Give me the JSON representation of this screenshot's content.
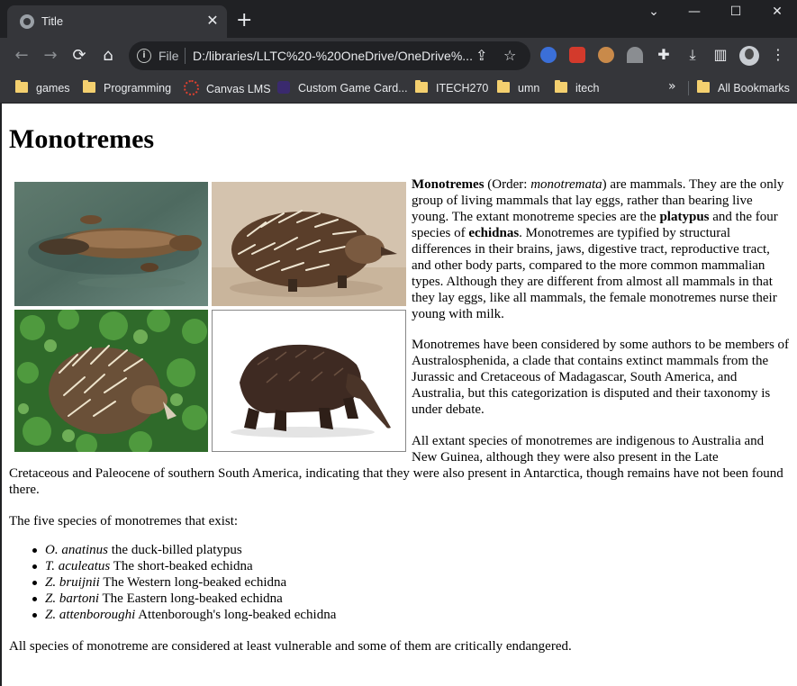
{
  "browser": {
    "tab": {
      "title": "Title",
      "close_glyph": "✕",
      "favicon": "globe-icon"
    },
    "new_tab_glyph": "+",
    "window_controls": {
      "collapse": "⌄",
      "minimize": "—",
      "maximize": "☐",
      "close": "✕"
    },
    "toolbar": {
      "back": "←",
      "forward": "→",
      "reload": "⟳",
      "home": "⌂",
      "scheme": "File",
      "url": "D:/libraries/LLTC%20-%20OneDrive/OneDrive%...",
      "share": "⇪",
      "bookmark_star": "☆",
      "extensions_glyph": "✚",
      "download": "⤓",
      "side_panel": "▥",
      "menu": "⋮"
    },
    "bookmarks": {
      "items": [
        {
          "label": "games",
          "icon": "folder-icon"
        },
        {
          "label": "Programming",
          "icon": "folder-icon"
        },
        {
          "label": "Canvas LMS",
          "icon": "canvas-icon"
        },
        {
          "label": "Custom Game Card...",
          "icon": "hex-icon"
        },
        {
          "label": "ITECH270",
          "icon": "folder-icon"
        },
        {
          "label": "umn",
          "icon": "folder-icon"
        },
        {
          "label": "itech",
          "icon": "folder-icon"
        }
      ],
      "overflow_glyph": "»",
      "all_bookmarks": "All Bookmarks"
    }
  },
  "page": {
    "heading": "Monotremes",
    "images": [
      {
        "subject": "duck-billed platypus swimming"
      },
      {
        "subject": "short-beaked echidna walking"
      },
      {
        "subject": "echidna in grass"
      },
      {
        "subject": "long-beaked echidna"
      }
    ],
    "intro": {
      "b1": "Monotremes",
      "t1": " (Order: ",
      "i1": "monotremata",
      "t2": ") are mammals. They are the only group of living mammals that lay eggs, rather than bearing live young. The extant monotreme species are the ",
      "b2": "platypus",
      "t3": " and the four species of ",
      "b3": "echidnas",
      "t4": ". Monotremes are typified by structural differences in their brains, jaws, digestive tract, reproductive tract, and other body parts, compared to the more common mammalian types. Although they are different from almost all mammals in that they lay eggs, like all mammals, the female monotremes nurse their young with milk."
    },
    "paragraph2": "Monotremes have been considered by some authors to be members of Australosphenida, a clade that contains extinct mammals from the Jurassic and Cretaceous of Madagascar, South America, and Australia, but this categorization is disputed and their taxonomy is under debate.",
    "paragraph3_a": "All extant species of monotremes are indigenous to Australia and New Guinea, although they were also present in the Late",
    "paragraph3_b": "Cretaceous and Paleocene of southern South America, indicating that they were also present in Antarctica, though remains have not been found there.",
    "species_intro": "The five species of monotremes that exist:",
    "species": [
      {
        "sci": "O. anatinus",
        "common": " the duck-billed platypus"
      },
      {
        "sci": "T. aculeatus",
        "common": " The short-beaked echidna"
      },
      {
        "sci": "Z. bruijnii",
        "common": " The Western long-beaked echidna"
      },
      {
        "sci": "Z. bartoni",
        "common": " The Eastern long-beaked echidna"
      },
      {
        "sci": "Z. attenboroughi",
        "common": " Attenborough's long-beaked echidna"
      }
    ],
    "closing": "All species of monotreme are considered at least vulnerable and some of them are critically endangered."
  }
}
